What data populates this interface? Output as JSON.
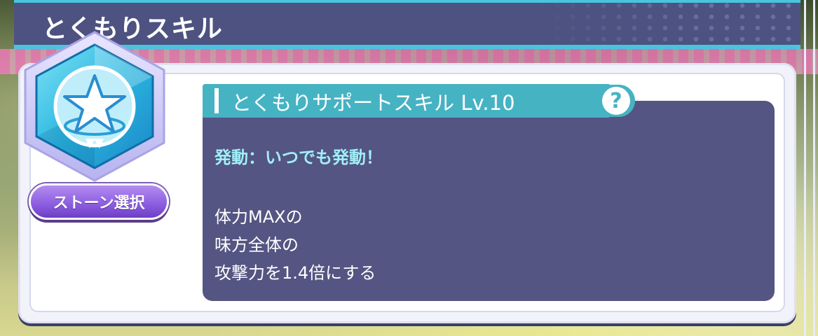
{
  "header": {
    "title": "とくもりスキル"
  },
  "skill": {
    "name": "とくもりサポートスキル Lv.10",
    "help_glyph": "?",
    "trigger": "発動：いつでも発動！",
    "effect_lines": [
      "体力MAXの",
      "味方全体の",
      "攻撃力を1.4倍にする"
    ]
  },
  "stone_button": {
    "label": "ストーン選択"
  },
  "icons": {
    "skill_gem": "star-hexagon-gem-icon",
    "help": "question-mark-icon"
  },
  "colors": {
    "header_bg": "#4d5280",
    "header_accent": "#49c4dc",
    "panel_bg": "#545582",
    "tab_accent": "#46b3c3",
    "trigger_text": "#9ff0f7",
    "button_purple": "#8b5ce0"
  }
}
